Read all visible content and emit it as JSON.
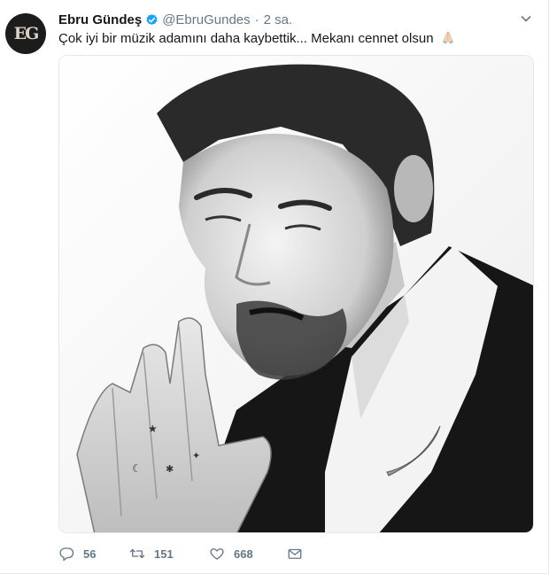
{
  "tweet": {
    "author": {
      "name": "Ebru Gündeş",
      "handle": "@EbruGundes",
      "avatar_initials": "EG",
      "verified": true
    },
    "separator": "·",
    "time": "2 sa.",
    "text": "Çok iyi bir müzik adamını daha kaybettik... Mekanı cennet olsun",
    "emoji": "folded-hands",
    "media": {
      "kind": "black-and-white portrait photo"
    },
    "stats": {
      "replies": "56",
      "retweets": "151",
      "likes": "668"
    },
    "icons": {
      "reply": "reply-icon",
      "retweet": "retweet-icon",
      "like": "heart-icon",
      "dm": "envelope-icon",
      "more": "chevron-down-icon",
      "verified": "verified-badge-icon"
    }
  },
  "colors": {
    "text": "#14171a",
    "secondary": "#657786",
    "verified": "#1da1f2",
    "border": "#e6ecf0"
  }
}
